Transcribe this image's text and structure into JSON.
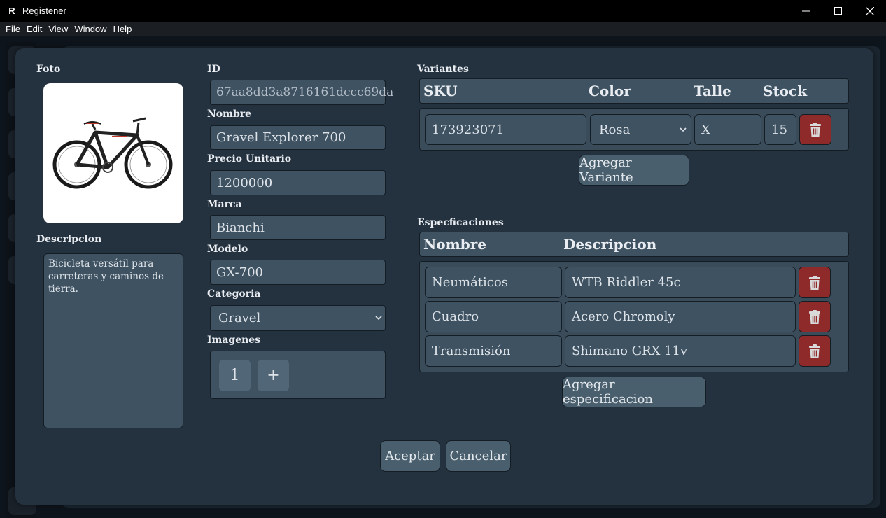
{
  "window": {
    "title": "Registener",
    "app_icon_glyph": "R"
  },
  "menu": [
    "File",
    "Edit",
    "View",
    "Window",
    "Help"
  ],
  "labels": {
    "foto": "Foto",
    "descripcion": "Descripcion",
    "id": "ID",
    "nombre": "Nombre",
    "precio": "Precio Unitario",
    "marca": "Marca",
    "modelo": "Modelo",
    "categoria": "Categoria",
    "imagenes": "Imagenes",
    "variantes": "Variantes",
    "especificaciones": "Especficaciones"
  },
  "product": {
    "id": "67aa8dd3a8716161dccc69da",
    "nombre": "Gravel Explorer 700",
    "precio": "1200000",
    "marca": "Bianchi",
    "modelo": "GX-700",
    "categoria": "Gravel",
    "descripcion": "Bicicleta versátil para carreteras y caminos de tierra."
  },
  "imagenes": {
    "items": [
      "1"
    ],
    "add_label": "+"
  },
  "variantes": {
    "headers": [
      "SKU",
      "Color",
      "Talle",
      "Stock"
    ],
    "rows": [
      {
        "sku": "173923071",
        "color": "Rosa",
        "talle": "X",
        "stock": "15"
      }
    ],
    "add_label": "Agregar Variante"
  },
  "especificaciones": {
    "headers": [
      "Nombre",
      "Descripcion"
    ],
    "rows": [
      {
        "nombre": "Neumáticos",
        "descripcion": "WTB Riddler 45c"
      },
      {
        "nombre": "Cuadro",
        "descripcion": "Acero Chromoly"
      },
      {
        "nombre": "Transmisión",
        "descripcion": "Shimano GRX 11v"
      }
    ],
    "add_label": "Agregar especificacion"
  },
  "actions": {
    "accept": "Aceptar",
    "cancel": "Cancelar"
  },
  "colors": {
    "dialog": "#243240",
    "field": "#3f5262",
    "delete": "#8f2a2a",
    "titlebar": "#000000"
  },
  "icons": {
    "minimize": "minimize-icon",
    "maximize": "maximize-icon",
    "close": "close-icon",
    "delete": "trash-icon",
    "dropdown": "chevron-down-icon"
  }
}
